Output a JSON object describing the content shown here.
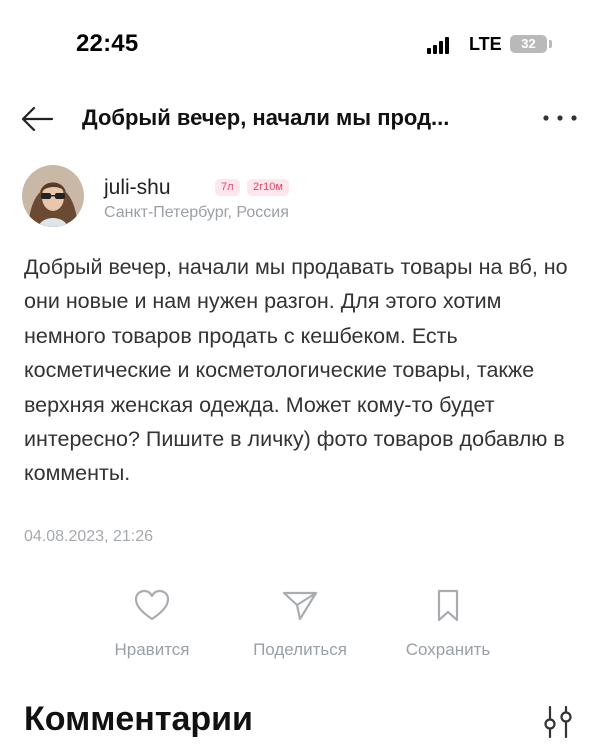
{
  "status_bar": {
    "time": "22:45",
    "network": "LTE",
    "battery": "32",
    "signal_bars": 4
  },
  "header": {
    "back_icon": "arrow-left-icon",
    "title": "Добрый вечер, начали мы прод...",
    "more_icon": "more-dots-icon"
  },
  "author": {
    "name": "juli-shu",
    "badges": [
      "7л",
      "2г10м"
    ],
    "location": "Санкт-Петербург, Россия"
  },
  "post": {
    "text": "Добрый вечер, начали мы продавать товары на вб, но они новые и нам нужен разгон. Для этого хотим немного товаров продать с кешбеком. Есть косметические и косметологические товары, также верхняя женская одежда. Может кому-то будет интересно? Пишите в личку) фото товаров добавлю в комменты.",
    "date": "04.08.2023, 21:26"
  },
  "actions": {
    "like_label": "Нравится",
    "share_label": "Поделиться",
    "save_label": "Сохранить"
  },
  "comments": {
    "title": "Комментарии",
    "filter_icon": "filter-icon"
  },
  "colors": {
    "badge_bg": "#fde7ec",
    "badge_text": "#e8476c",
    "muted_text": "#9aa0a6",
    "icon_stroke": "#a9adb2"
  }
}
